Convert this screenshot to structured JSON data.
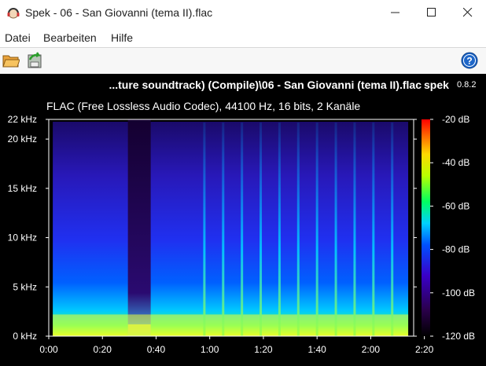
{
  "window": {
    "title": "Spek - 06 - San Giovanni (tema II).flac",
    "icon": "headphones-icon"
  },
  "menu": {
    "items": [
      "Datei",
      "Bearbeiten",
      "Hilfe"
    ]
  },
  "toolbar": {
    "open_icon": "folder-open-icon",
    "save_icon": "save-export-icon",
    "help_icon": "help-icon"
  },
  "spek": {
    "file_title": "...ture soundtrack) (Compile)\\06 - San Giovanni (tema II).flac",
    "brand": "spek",
    "version": "0.8.2",
    "info": "FLAC (Free Lossless Audio Codec), 44100 Hz, 16 bits, 2 Kanäle"
  },
  "chart_data": {
    "type": "heatmap",
    "title": "",
    "xlabel": "",
    "ylabel": "",
    "x_ticks": [
      "0:00",
      "0:20",
      "0:40",
      "1:00",
      "1:20",
      "1:40",
      "2:00",
      "2:20"
    ],
    "x_tick_values": [
      0,
      20,
      40,
      60,
      80,
      100,
      120,
      140
    ],
    "xlim": [
      0,
      136
    ],
    "y_ticks": [
      "0 kHz",
      "5 kHz",
      "10 kHz",
      "15 kHz",
      "20 kHz",
      "22 kHz"
    ],
    "y_tick_values": [
      0,
      5,
      10,
      15,
      20,
      22
    ],
    "ylim": [
      0,
      22
    ],
    "colorbar_ticks": [
      "-20 dB",
      "-40 dB",
      "-60 dB",
      "-80 dB",
      "-100 dB",
      "-120 dB"
    ],
    "colorbar_values": [
      -20,
      -40,
      -60,
      -80,
      -100,
      -120
    ],
    "colorbar_range": [
      -120,
      -20
    ]
  }
}
